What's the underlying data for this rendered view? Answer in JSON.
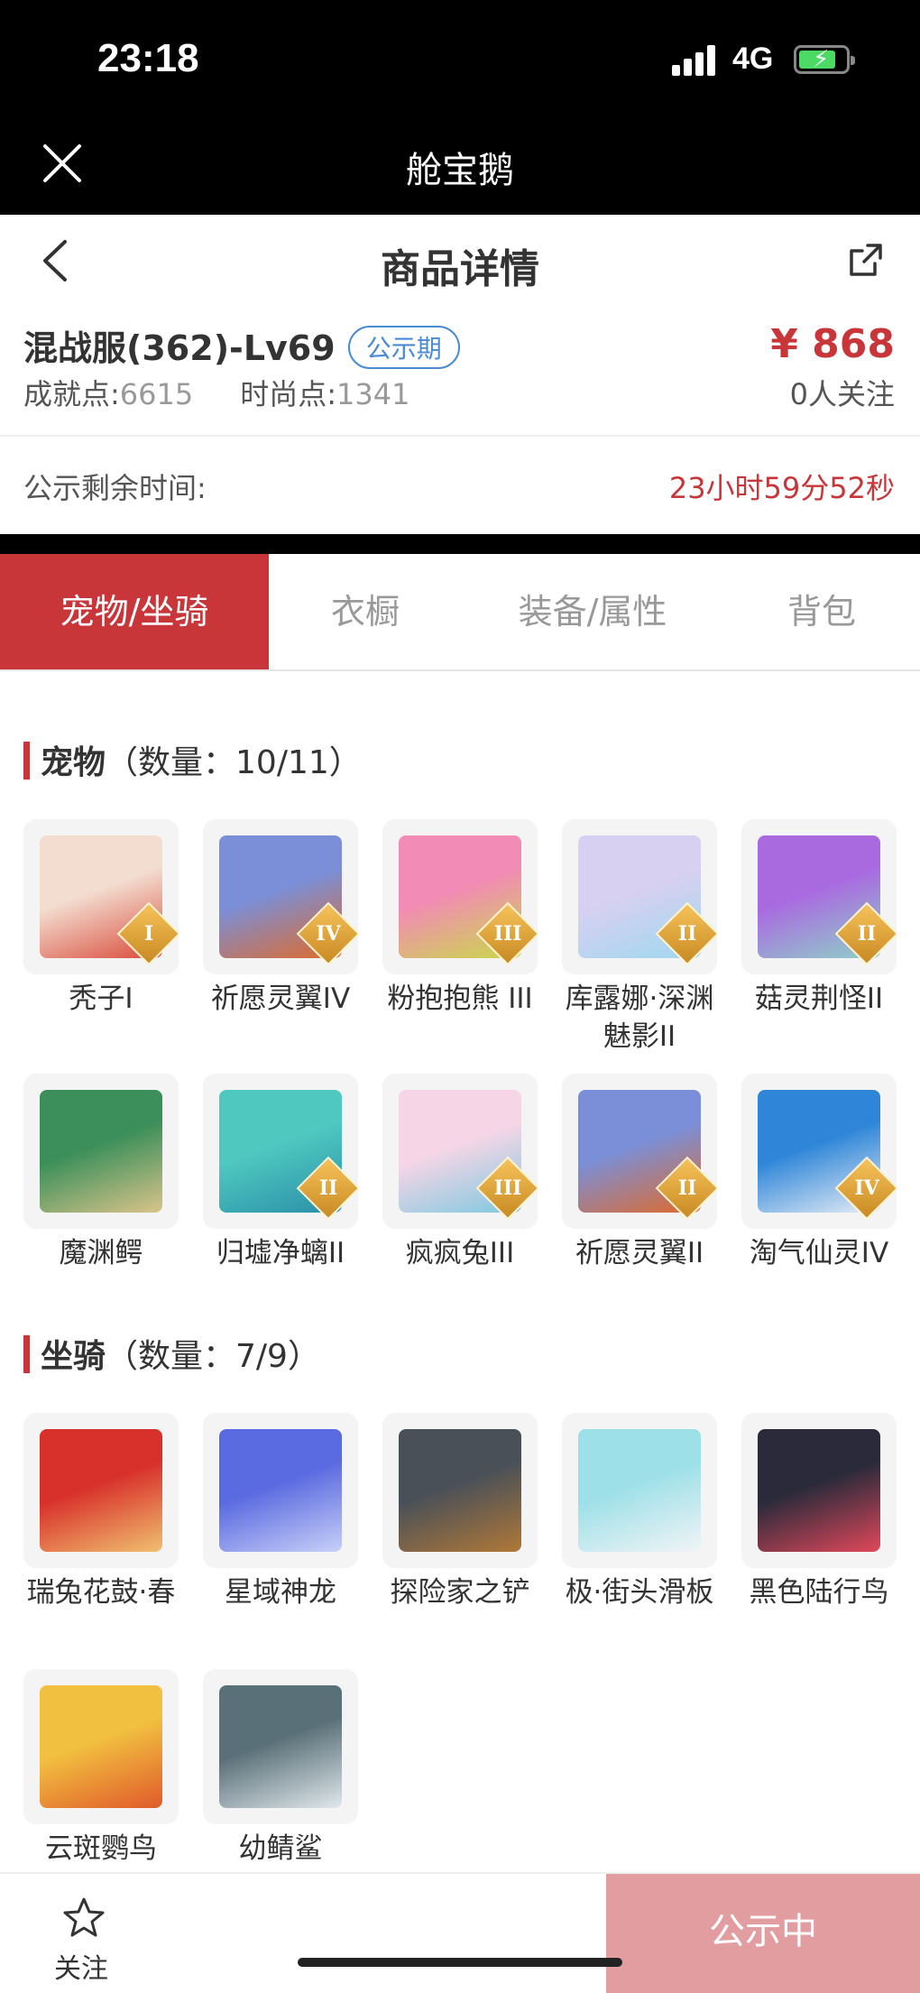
{
  "status_bar": {
    "time": "23:18",
    "network": "4G"
  },
  "nav": {
    "app_title": "舱宝鹅"
  },
  "header": {
    "title": "商品详情"
  },
  "product": {
    "title": "混战服(362)-Lv69",
    "badge": "公示期",
    "price": "¥ 868",
    "achievement_label": "成就点:",
    "achievement_value": "6615",
    "fashion_label": "时尚点:",
    "fashion_value": "1341",
    "followers": "0人关注",
    "remain_label": "公示剩余时间:",
    "remain_value": "23小时59分52秒"
  },
  "tabs": [
    {
      "label": "宠物/坐骑",
      "active": true
    },
    {
      "label": "衣橱",
      "active": false
    },
    {
      "label": "装备/属性",
      "active": false
    },
    {
      "label": "背包",
      "active": false
    }
  ],
  "pets": {
    "title": "宠物",
    "count": "（数量：10/11）",
    "items": [
      {
        "name": "秃子I",
        "grade": "I",
        "colors": [
          "#f3ddd0",
          "#d94b3a"
        ]
      },
      {
        "name": "祈愿灵翼IV",
        "grade": "IV",
        "colors": [
          "#7a8fd8",
          "#e06a2a"
        ]
      },
      {
        "name": "粉抱抱熊 III",
        "grade": "III",
        "colors": [
          "#f28bb5",
          "#c9d94a"
        ]
      },
      {
        "name": "库露娜·深渊魅影II",
        "grade": "II",
        "colors": [
          "#d8d0f0",
          "#9fd8f0"
        ]
      },
      {
        "name": "菇灵荆怪II",
        "grade": "II",
        "colors": [
          "#a96ae0",
          "#8fd0c8"
        ]
      },
      {
        "name": "魔渊鳄",
        "grade": "",
        "colors": [
          "#3c8f5a",
          "#d9c48a"
        ]
      },
      {
        "name": "归墟净螭II",
        "grade": "II",
        "colors": [
          "#4fc8c0",
          "#2a8fa8"
        ]
      },
      {
        "name": "疯疯兔III",
        "grade": "III",
        "colors": [
          "#f6d6e6",
          "#7ec8e0"
        ]
      },
      {
        "name": "祈愿灵翼II",
        "grade": "II",
        "colors": [
          "#7a8fd8",
          "#e06a2a"
        ]
      },
      {
        "name": "淘气仙灵IV",
        "grade": "IV",
        "colors": [
          "#2f86d8",
          "#e8eef6"
        ]
      }
    ]
  },
  "mounts": {
    "title": "坐骑",
    "count": "（数量：7/9）",
    "items": [
      {
        "name": "瑞兔花鼓·春",
        "grade": "",
        "colors": [
          "#d8302a",
          "#f0c070"
        ]
      },
      {
        "name": "星域神龙",
        "grade": "",
        "colors": [
          "#5a6ae0",
          "#c8d0f8"
        ]
      },
      {
        "name": "探险家之铲",
        "grade": "",
        "colors": [
          "#4a5058",
          "#b07838"
        ]
      },
      {
        "name": "极·街头滑板",
        "grade": "",
        "colors": [
          "#9ee0e8",
          "#f0f4f6"
        ]
      },
      {
        "name": "黑色陆行鸟",
        "grade": "",
        "colors": [
          "#2a2a3a",
          "#e0485a"
        ]
      },
      {
        "name": "云斑鹦鸟",
        "grade": "",
        "colors": [
          "#f2c040",
          "#e05a2a"
        ]
      },
      {
        "name": "幼鲭鲨",
        "grade": "",
        "colors": [
          "#5a7078",
          "#e0e8ec"
        ]
      }
    ]
  },
  "bottom": {
    "follow_label": "关注",
    "status_button": "公示中"
  }
}
